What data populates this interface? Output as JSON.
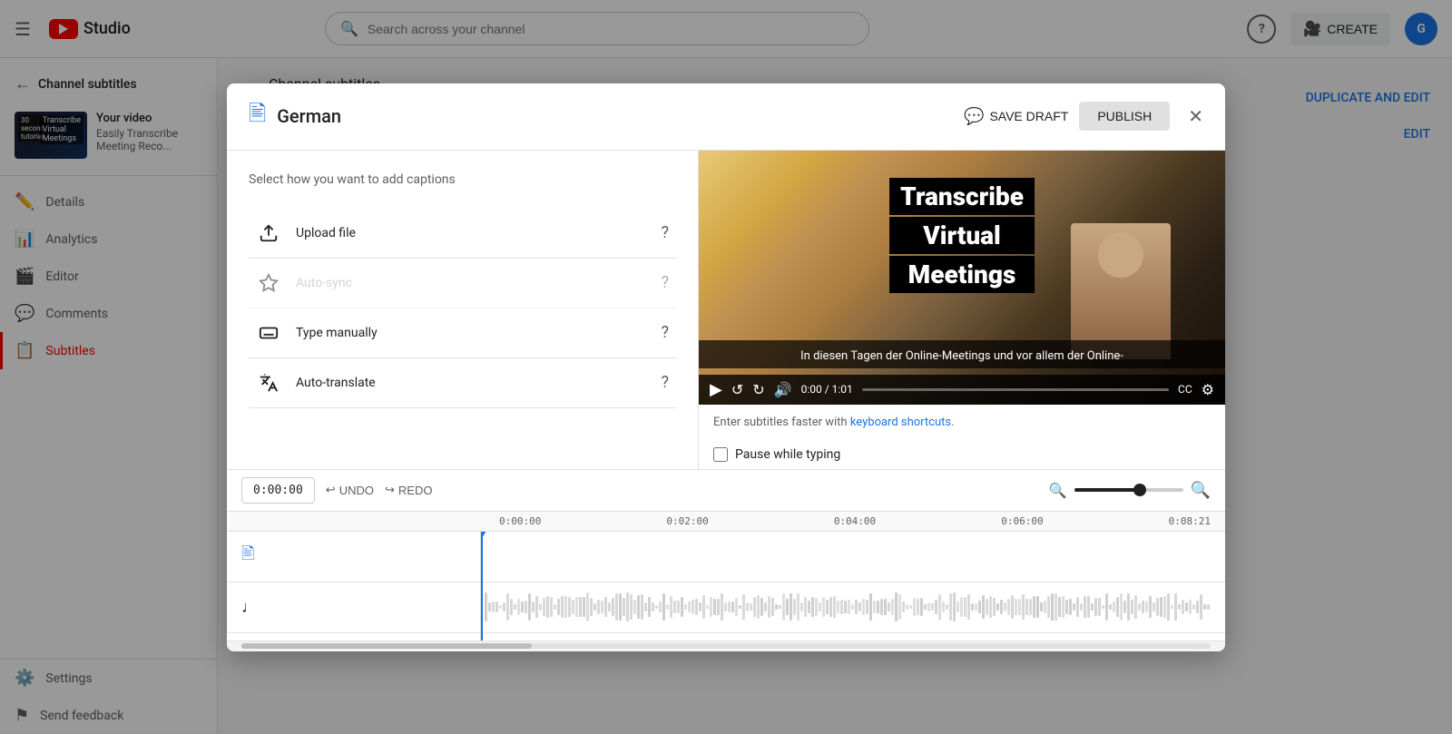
{
  "app": {
    "name": "YouTube Studio",
    "logo_text": "Studio"
  },
  "topbar": {
    "search_placeholder": "Search across your channel",
    "create_label": "CREATE"
  },
  "sidebar": {
    "back_label": "Channel subtitles",
    "video_title": "Easily Transcribe Meeting Reco...",
    "items": [
      {
        "id": "details",
        "label": "Details",
        "icon": "✏️",
        "active": false
      },
      {
        "id": "analytics",
        "label": "Analytics",
        "icon": "📊",
        "active": false
      },
      {
        "id": "editor",
        "label": "Editor",
        "icon": "🎬",
        "active": false
      },
      {
        "id": "comments",
        "label": "Comments",
        "icon": "💬",
        "active": false
      },
      {
        "id": "subtitles",
        "label": "Subtitles",
        "icon": "📋",
        "active": true
      }
    ],
    "bottom_items": [
      {
        "id": "settings",
        "label": "Settings",
        "icon": "⚙️"
      },
      {
        "id": "send-feedback",
        "label": "Send feedback",
        "icon": "⚑"
      }
    ]
  },
  "modal": {
    "title": "German",
    "save_draft_label": "SAVE DRAFT",
    "publish_label": "PUBLISH",
    "captions_section_title": "Select how you want to add captions",
    "options": [
      {
        "id": "upload-file",
        "label": "Upload file",
        "disabled": false,
        "icon": "upload"
      },
      {
        "id": "auto-sync",
        "label": "Auto-sync",
        "disabled": true,
        "icon": "sparkle"
      },
      {
        "id": "type-manually",
        "label": "Type manually",
        "disabled": false,
        "icon": "keyboard"
      },
      {
        "id": "auto-translate",
        "label": "Auto-translate",
        "disabled": false,
        "icon": "translate"
      }
    ],
    "video": {
      "overlay_line1": "Transcribe",
      "overlay_line2": "Virtual",
      "overlay_line3": "Meetings",
      "subtitle_text": "In diesen Tagen der Online-Meetings und vor allem der Online-",
      "time_current": "0:00",
      "time_total": "1:01"
    },
    "keyboard_shortcuts_text": "Enter subtitles faster with",
    "keyboard_shortcuts_link": "keyboard shortcuts.",
    "pause_while_typing": "Pause while typing",
    "timeline": {
      "time_display": "0:00:00",
      "undo_label": "UNDO",
      "redo_label": "REDO",
      "ruler_marks": [
        "0:00:00",
        "0:02:00",
        "0:04:00",
        "0:06:00",
        "0:08:21"
      ]
    }
  },
  "behind": {
    "duplicate_edit_label": "DUPLICATE AND EDIT",
    "edit_label": "EDIT"
  }
}
